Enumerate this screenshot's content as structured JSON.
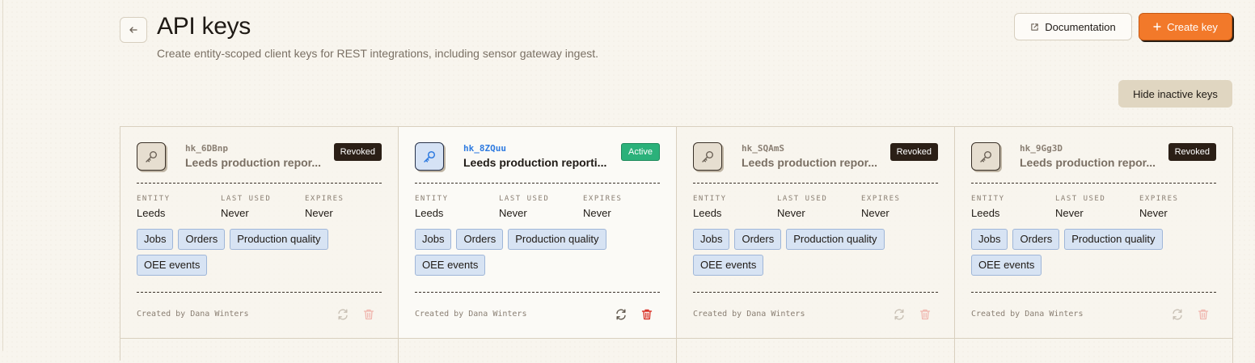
{
  "header": {
    "title": "API keys",
    "subtitle": "Create entity-scoped client keys for REST integrations, including sensor gateway ingest.",
    "documentation_label": "Documentation",
    "create_label": "Create key",
    "hide_inactive_label": "Hide inactive keys"
  },
  "meta_labels": {
    "entity": "ENTITY",
    "last_used": "LAST USED",
    "expires": "EXPIRES"
  },
  "colors": {
    "accent": "#f2792a",
    "active": "#2bb17a",
    "revoked": "#2b1f16",
    "tag": "#d7e3f3"
  },
  "keys": [
    {
      "id": "hk_6DBnp",
      "name": "Leeds production repor...",
      "status": "Revoked",
      "entity": "Leeds",
      "last_used": "Never",
      "expires": "Never",
      "scopes": [
        "Jobs",
        "Orders",
        "Production quality",
        "OEE events"
      ],
      "created_by": "Created by Dana Winters"
    },
    {
      "id": "hk_8ZQuu",
      "name": "Leeds production reporti...",
      "status": "Active",
      "entity": "Leeds",
      "last_used": "Never",
      "expires": "Never",
      "scopes": [
        "Jobs",
        "Orders",
        "Production quality",
        "OEE events"
      ],
      "created_by": "Created by Dana Winters"
    },
    {
      "id": "hk_SQAmS",
      "name": "Leeds production repor...",
      "status": "Revoked",
      "entity": "Leeds",
      "last_used": "Never",
      "expires": "Never",
      "scopes": [
        "Jobs",
        "Orders",
        "Production quality",
        "OEE events"
      ],
      "created_by": "Created by Dana Winters"
    },
    {
      "id": "hk_9Gg3D",
      "name": "Leeds production repor...",
      "status": "Revoked",
      "entity": "Leeds",
      "last_used": "Never",
      "expires": "Never",
      "scopes": [
        "Jobs",
        "Orders",
        "Production quality",
        "OEE events"
      ],
      "created_by": "Created by Dana Winters"
    }
  ]
}
